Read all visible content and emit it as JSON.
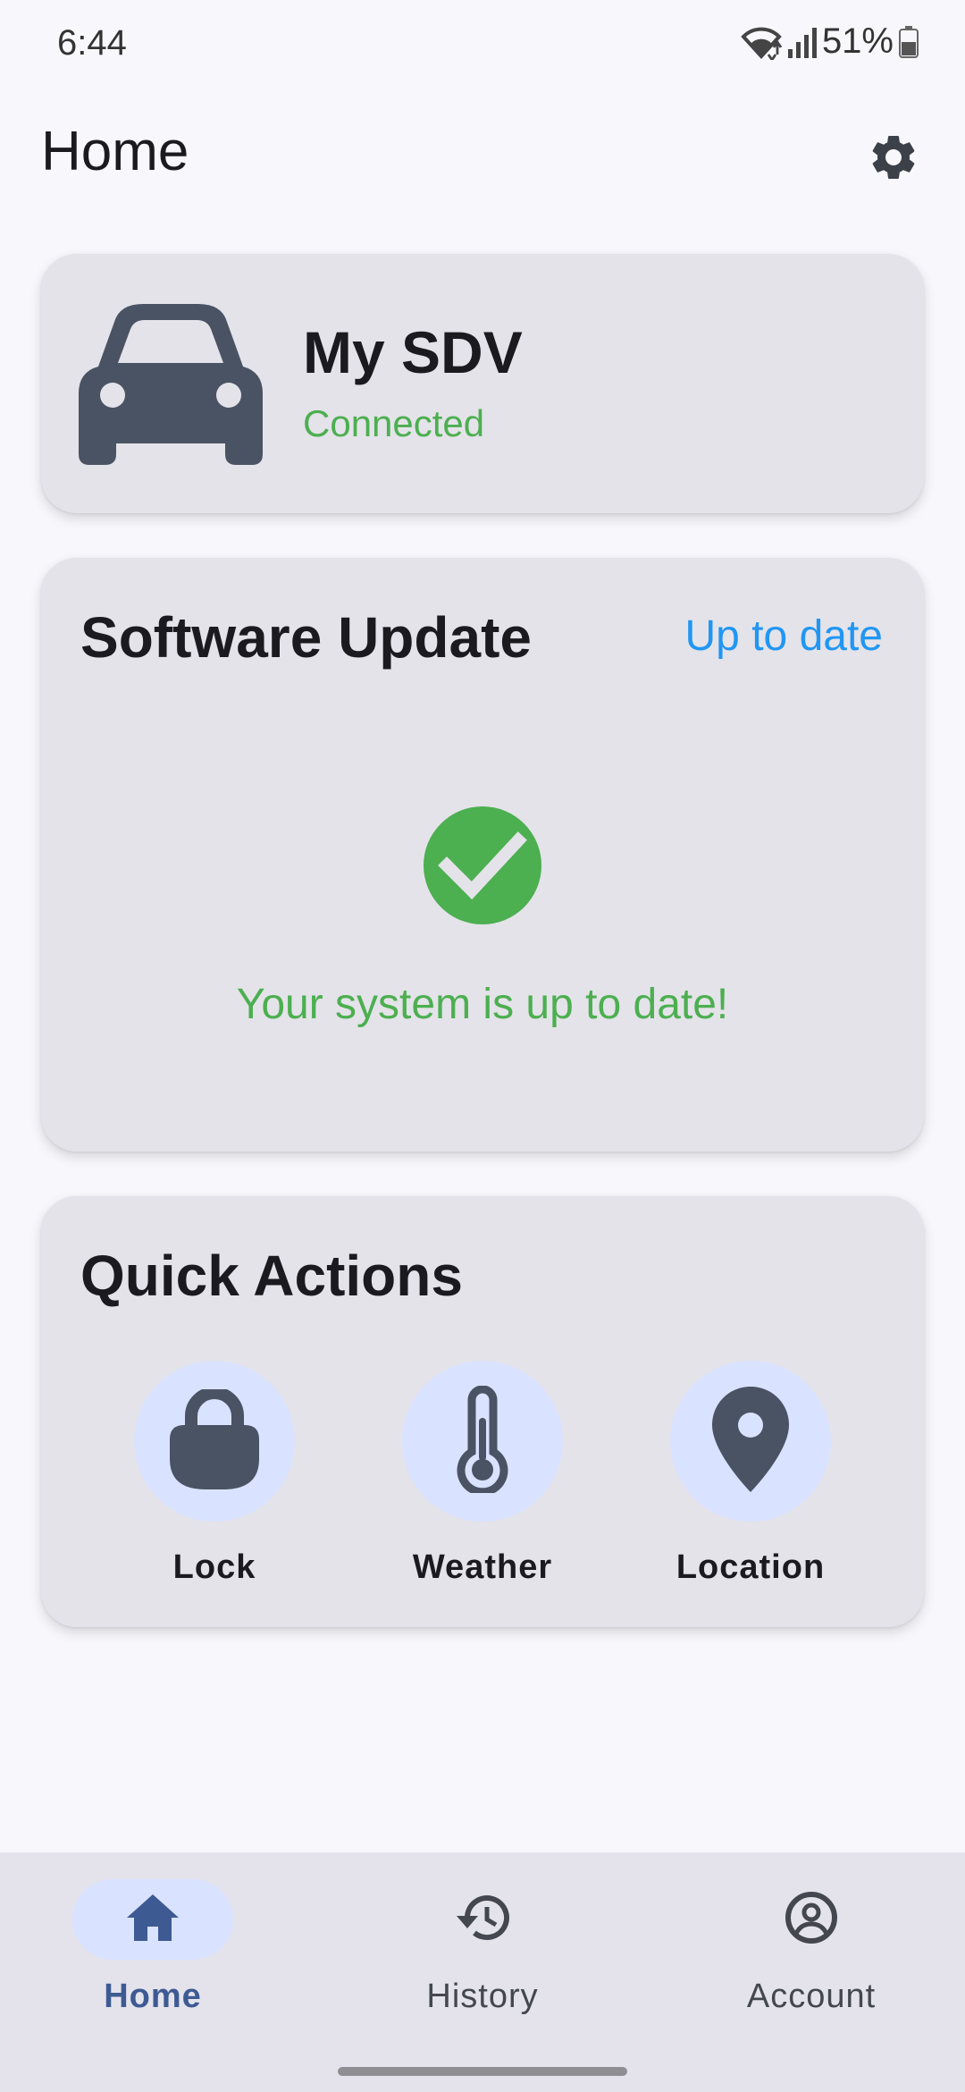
{
  "status_bar": {
    "time": "6:44",
    "battery": "51%"
  },
  "app_bar": {
    "title": "Home",
    "settings_icon": "gear-icon"
  },
  "vehicle": {
    "icon": "car-icon",
    "name": "My SDV",
    "status": "Connected",
    "status_color": "#4caf50"
  },
  "software_update": {
    "title": "Software Update",
    "status_link": "Up to date",
    "status_link_color": "#2196f3",
    "icon": "check-circle-icon",
    "message": "Your system is up to date!",
    "message_color": "#4caf50"
  },
  "quick_actions": {
    "title": "Quick Actions",
    "items": [
      {
        "label": "Lock",
        "icon": "lock-icon"
      },
      {
        "label": "Weather",
        "icon": "thermometer-icon"
      },
      {
        "label": "Location",
        "icon": "location-pin-icon"
      }
    ]
  },
  "bottom_nav": {
    "items": [
      {
        "label": "Home",
        "icon": "home-icon",
        "active": true
      },
      {
        "label": "History",
        "icon": "history-icon",
        "active": false
      },
      {
        "label": "Account",
        "icon": "account-circle-icon",
        "active": false
      }
    ],
    "active_color": "#3e5a93"
  },
  "colors": {
    "card_background": "#e4e3e9",
    "icon_dark": "#4a5363",
    "action_circle": "#d9e2ff"
  }
}
